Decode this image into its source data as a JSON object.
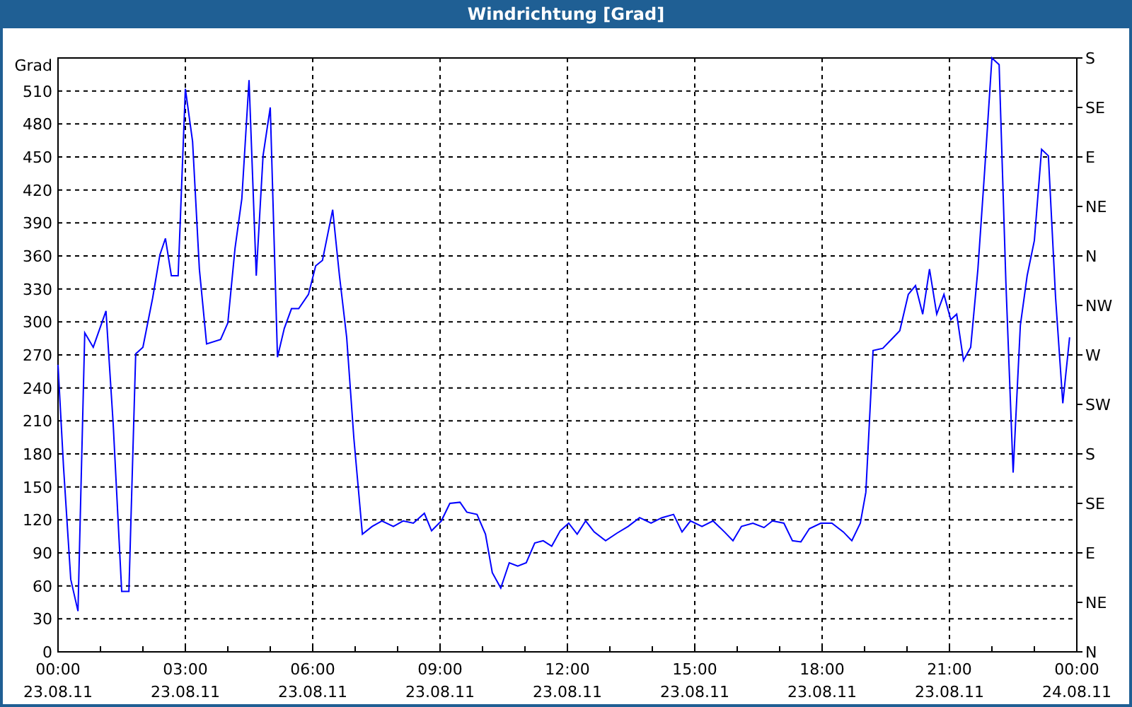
{
  "window": {
    "title": "Windrichtung [Grad]"
  },
  "chart": {
    "chart_data": {
      "type": "line",
      "ylabel": "Grad",
      "xlim": [
        0,
        24
      ],
      "ylim": [
        0,
        540
      ],
      "x": [
        0,
        0.13,
        0.3,
        0.47,
        0.63,
        0.83,
        1.13,
        1.3,
        1.5,
        1.67,
        1.83,
        2.0,
        2.23,
        2.4,
        2.53,
        2.67,
        2.83,
        3.0,
        3.17,
        3.33,
        3.5,
        3.83,
        4.0,
        4.17,
        4.33,
        4.5,
        4.67,
        4.83,
        5.0,
        5.17,
        5.33,
        5.5,
        5.67,
        5.9,
        6.07,
        6.23,
        6.47,
        6.63,
        6.8,
        6.97,
        7.17,
        7.4,
        7.63,
        7.9,
        8.13,
        8.37,
        8.63,
        8.8,
        9.03,
        9.23,
        9.47,
        9.63,
        9.87,
        10.07,
        10.23,
        10.43,
        10.63,
        10.83,
        11.03,
        11.23,
        11.43,
        11.63,
        11.83,
        12.03,
        12.23,
        12.43,
        12.63,
        12.9,
        13.17,
        13.43,
        13.7,
        13.97,
        14.23,
        14.5,
        14.7,
        14.9,
        15.17,
        15.43,
        15.7,
        15.9,
        16.1,
        16.37,
        16.63,
        16.83,
        17.1,
        17.3,
        17.5,
        17.7,
        17.97,
        18.23,
        18.5,
        18.7,
        18.9,
        19.03,
        19.2,
        19.43,
        19.63,
        19.83,
        20.03,
        20.2,
        20.37,
        20.53,
        20.7,
        20.87,
        21.03,
        21.17,
        21.33,
        21.5,
        21.67,
        21.83,
        22.0,
        22.17,
        22.33,
        22.5,
        22.67,
        22.83,
        23.0,
        23.17,
        23.33,
        23.5,
        23.67,
        23.83
      ],
      "grid": true,
      "series": [
        {
          "color": "#0000ff",
          "values": [
            261,
            168,
            66,
            37,
            290,
            277,
            310,
            207,
            55,
            55,
            271,
            277,
            322,
            361,
            376,
            342,
            342,
            512,
            464,
            348,
            280,
            284,
            299,
            367,
            412,
            520,
            342,
            451,
            495,
            268,
            294,
            312,
            312,
            325,
            351,
            356,
            402,
            342,
            286,
            194,
            107,
            114,
            119,
            114,
            119,
            117,
            126,
            110,
            119,
            135,
            136,
            127,
            125,
            107,
            72,
            58,
            81,
            78,
            81,
            99,
            101,
            96,
            110,
            117,
            107,
            119,
            109,
            101,
            108,
            114,
            122,
            117,
            122,
            125,
            109,
            119,
            114,
            119,
            109,
            101,
            114,
            117,
            113,
            119,
            117,
            101,
            100,
            112,
            117,
            117,
            109,
            101,
            117,
            145,
            274,
            276,
            284,
            292,
            325,
            333,
            307,
            348,
            307,
            325,
            302,
            307,
            265,
            277,
            348,
            438,
            540,
            534,
            335,
            163,
            297,
            342,
            374,
            457,
            451,
            322,
            226,
            286
          ]
        }
      ],
      "xticks": [
        {
          "value": 0,
          "label": "00:00"
        },
        {
          "value": 3,
          "label": "03:00"
        },
        {
          "value": 6,
          "label": "06:00"
        },
        {
          "value": 9,
          "label": "09:00"
        },
        {
          "value": 12,
          "label": "12:00"
        },
        {
          "value": 15,
          "label": "15:00"
        },
        {
          "value": 18,
          "label": "18:00"
        },
        {
          "value": 21,
          "label": "21:00"
        },
        {
          "value": 24,
          "label": "00:00"
        }
      ],
      "yticks": [
        0,
        30,
        60,
        90,
        120,
        150,
        180,
        210,
        240,
        270,
        300,
        330,
        360,
        390,
        420,
        450,
        480,
        510
      ]
    },
    "date_labels": [
      "23.08.11",
      "23.08.11",
      "23.08.11",
      "23.08.11",
      "23.08.11",
      "23.08.11",
      "23.08.11",
      "23.08.11",
      "24.08.11"
    ],
    "compass_ticks": [
      "S",
      "SE",
      "E",
      "NE",
      "N",
      "NW",
      "W",
      "SW",
      "S",
      "SE",
      "E",
      "NE",
      "N"
    ]
  }
}
